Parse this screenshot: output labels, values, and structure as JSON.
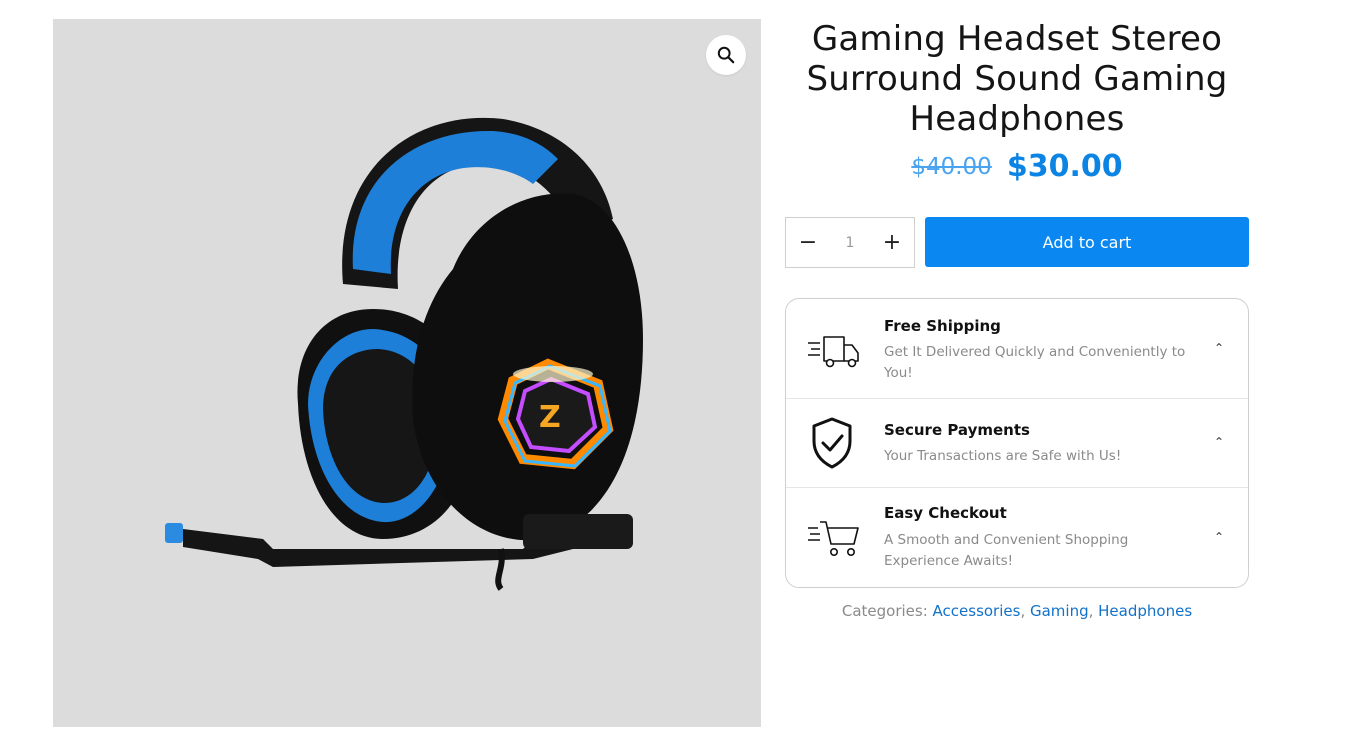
{
  "product": {
    "title": "Gaming Headset Stereo Surround Sound Gaming Headphones",
    "price_old": "$40.00",
    "price_new": "$30.00"
  },
  "gallery": {
    "zoom_icon": "magnifier-icon"
  },
  "cart": {
    "minus_label": "−",
    "quantity": "1",
    "plus_label": "+",
    "add_label": "Add to cart"
  },
  "features": [
    {
      "title": "Free Shipping",
      "desc": "Get It Delivered Quickly and Conveniently to You!",
      "icon": "delivery-truck-icon"
    },
    {
      "title": "Secure Payments",
      "desc": "Your Transactions are Safe with Us!",
      "icon": "shield-check-icon"
    },
    {
      "title": "Easy Checkout",
      "desc": "A Smooth and Convenient Shopping Experience Awaits!",
      "icon": "shopping-cart-icon"
    }
  ],
  "categories": {
    "label": "Categories:",
    "items": [
      "Accessories",
      "Gaming",
      "Headphones"
    ]
  },
  "colors": {
    "accent": "#0a87f0",
    "price": "#0c84e4",
    "link": "#1272c9"
  }
}
